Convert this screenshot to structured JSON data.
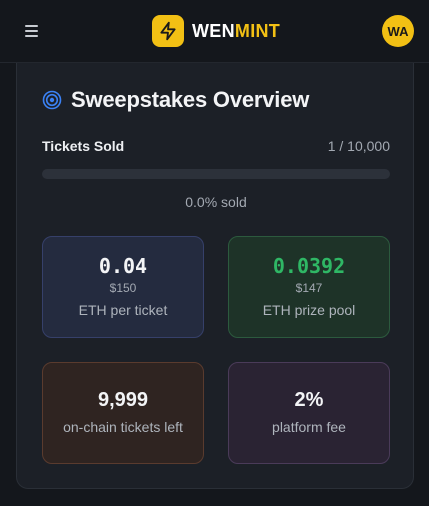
{
  "header": {
    "brand_part1": "WEN",
    "brand_part2": "MINT",
    "avatar_initials": "WA",
    "logo_icon": "lightning-bolt-icon",
    "menu_icon": "hamburger-menu-icon"
  },
  "overview": {
    "title": "Sweepstakes Overview",
    "title_icon": "target-icon",
    "tickets_sold_label": "Tickets Sold",
    "tickets_sold_count": "1 / 10,000",
    "progress_fraction": 0.0,
    "percent_sold_text": "0.0% sold"
  },
  "stats": {
    "ticket_price": {
      "value": "0.04",
      "usd": "$150",
      "label": "ETH per ticket"
    },
    "prize_pool": {
      "value": "0.0392",
      "usd": "$147",
      "label": "ETH prize pool"
    },
    "tickets_left": {
      "value": "9,999",
      "label": "on-chain tickets left"
    },
    "platform_fee": {
      "value": "2%",
      "label": "platform fee"
    }
  },
  "colors": {
    "accent": "#f2c014",
    "prize_green": "#2fb765"
  }
}
